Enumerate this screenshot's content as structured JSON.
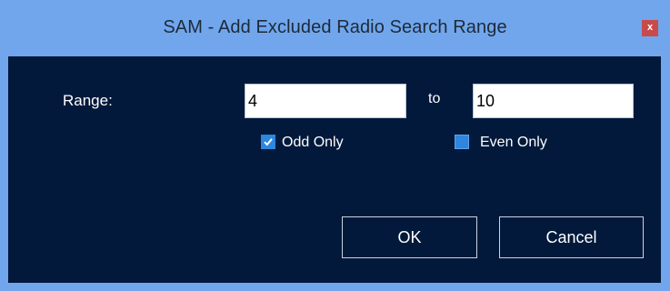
{
  "window": {
    "title": "SAM - Add Excluded Radio Search Range",
    "close_label": "x"
  },
  "form": {
    "range_label": "Range:",
    "range_from": "4",
    "to_label": "to",
    "range_to": "10",
    "odd_only": {
      "label": "Odd Only",
      "checked": true
    },
    "even_only": {
      "label": "Even Only",
      "checked": false
    }
  },
  "buttons": {
    "ok_label": "OK",
    "cancel_label": "Cancel"
  },
  "colors": {
    "titlebar": "#71a6ec",
    "client_bg": "#02193b",
    "close_btn": "#c84a4a",
    "checkbox": "#2e86de"
  }
}
